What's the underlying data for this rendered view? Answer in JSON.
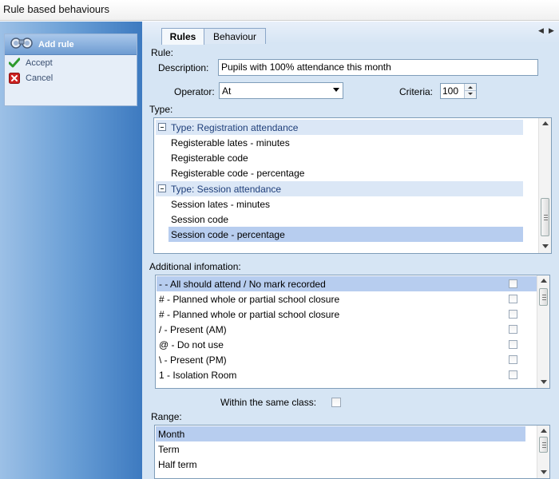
{
  "window": {
    "title": "Rule based behaviours"
  },
  "sidebar": {
    "header_label": "Add rule",
    "header_icon": "binoculars-icon",
    "items": [
      {
        "label": "Accept",
        "icon": "check-icon"
      },
      {
        "label": "Cancel",
        "icon": "cancel-icon"
      }
    ]
  },
  "tabs": [
    {
      "label": "Rules",
      "active": true
    },
    {
      "label": "Behaviour",
      "active": false
    }
  ],
  "form": {
    "rule_label": "Rule:",
    "description_label": "Description:",
    "description_value": "Pupils with 100% attendance this month",
    "operator_label": "Operator:",
    "operator_value": "At",
    "criteria_label": "Criteria:",
    "criteria_value": "100",
    "type_label": "Type:",
    "additional_label": "Additional infomation:",
    "same_class_label": "Within the same class:",
    "range_label": "Range:"
  },
  "type_list": {
    "groups": [
      {
        "header": "Type:  Registration attendance",
        "items": [
          "Registerable lates - minutes",
          "Registerable code",
          "Registerable code - percentage"
        ]
      },
      {
        "header": "Type:  Session attendance",
        "items": [
          "Session lates - minutes",
          "Session code",
          "Session code - percentage"
        ]
      }
    ],
    "selected": "Session code - percentage"
  },
  "additional_list": {
    "items": [
      "- - All should attend / No mark recorded",
      "# - Planned whole or partial school closure",
      "# - Planned whole or partial school closure",
      "/ - Present (AM)",
      "@ - Do not use",
      "\\ - Present (PM)",
      "1 - Isolation Room"
    ],
    "selected_index": 0
  },
  "range_list": {
    "items": [
      "Month",
      "Term",
      "Half term"
    ],
    "selected_index": 0
  },
  "colors": {
    "selection": "#b7cdef",
    "group_header": "#dbe7f6",
    "accept_icon": "#2e9a2e",
    "cancel_icon": "#cc2222"
  }
}
